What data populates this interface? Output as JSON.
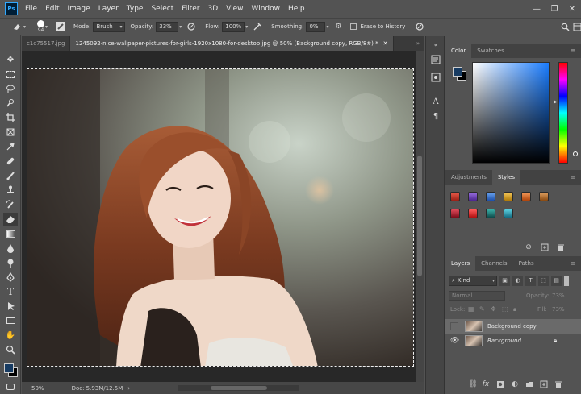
{
  "app": {
    "logo_text": "Ps",
    "menu": [
      "File",
      "Edit",
      "Image",
      "Layer",
      "Type",
      "Select",
      "Filter",
      "3D",
      "View",
      "Window",
      "Help"
    ],
    "window_controls": {
      "minimize": "—",
      "restore": "❐",
      "close": "✕"
    }
  },
  "options_bar": {
    "brush_size": "94",
    "mode_label": "Mode:",
    "mode_value": "Brush",
    "opacity_label": "Opacity:",
    "opacity_value": "33%",
    "flow_label": "Flow:",
    "flow_value": "100%",
    "smoothing_label": "Smoothing:",
    "smoothing_value": "0%",
    "erase_history_label": "Erase to History"
  },
  "tabs": [
    {
      "label": "c1c75517.jpg",
      "active": false
    },
    {
      "label": "1245092-nice-wallpaper-pictures-for-girls-1920x1080-for-desktop.jpg @ 50% (Background copy, RGB/8#) *",
      "active": true
    }
  ],
  "tab_overflow": "»",
  "status": {
    "zoom": "50%",
    "doc": "Doc: 5.93M/12.5M",
    "arrow": "›"
  },
  "color_panel": {
    "tabs": [
      "Color",
      "Swatches"
    ],
    "active_tab": "Color",
    "foreground_color": "#173b62",
    "background_color": "#000000"
  },
  "styles_panel": {
    "tabs": [
      "Adjustments",
      "Styles"
    ],
    "active_tab": "Styles",
    "swatches": [
      "#c0392b",
      "#6b3fb8",
      "#2f6fd6",
      "#e0a21a",
      "#e06a1a",
      "#c76a12",
      "#b71c2b",
      "#e02626",
      "#1f7a7a",
      "#2a9db0"
    ]
  },
  "layers_panel": {
    "tabs": [
      "Layers",
      "Channels",
      "Paths"
    ],
    "active_tab": "Layers",
    "kind_label": "Kind",
    "blend_mode": "Normal",
    "opacity_label": "Opacity:",
    "opacity_value": "73%",
    "lock_label": "Lock:",
    "fill_label": "Fill:",
    "fill_value": "73%",
    "layers": [
      {
        "name": "Background copy",
        "visible": false,
        "selected": true,
        "locked": false
      },
      {
        "name": "Background",
        "visible": true,
        "selected": false,
        "locked": true
      }
    ]
  }
}
